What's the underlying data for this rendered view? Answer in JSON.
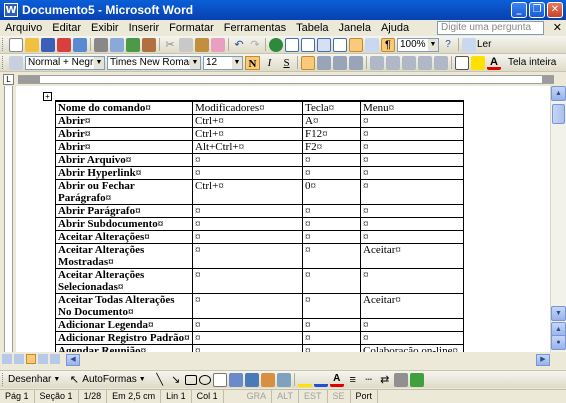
{
  "window": {
    "title": "Documento5 - Microsoft Word",
    "app_icon": "W"
  },
  "menu": [
    "Arquivo",
    "Editar",
    "Exibir",
    "Inserir",
    "Formatar",
    "Ferramentas",
    "Tabela",
    "Janela",
    "Ajuda"
  ],
  "help_box": {
    "placeholder": "Digite uma pergunta"
  },
  "standard_toolbar": {
    "zoom": "100%",
    "read_label": "Ler"
  },
  "format_toolbar": {
    "style": "Normal + Negrito",
    "font": "Times New Roman",
    "size": "12",
    "bold": "N",
    "italic": "I",
    "underline": "S",
    "full_screen_label": "Tela inteira"
  },
  "table": {
    "headers": [
      "Nome do comando",
      "Modificadores",
      "Tecla",
      "Menu"
    ],
    "rows": [
      [
        "Abrir",
        "Ctrl+",
        "A",
        ""
      ],
      [
        "Abrir",
        "Ctrl+",
        "F12",
        ""
      ],
      [
        "Abrir",
        "Alt+Ctrl+",
        "F2",
        ""
      ],
      [
        "Abrir Arquivo",
        "",
        "",
        ""
      ],
      [
        "Abrir Hyperlink",
        "",
        "",
        ""
      ],
      [
        "Abrir ou Fechar Parágrafo",
        "Ctrl+",
        "0",
        ""
      ],
      [
        "Abrir Parágrafo",
        "",
        "",
        ""
      ],
      [
        "Abrir Subdocumento",
        "",
        "",
        ""
      ],
      [
        "Aceitar Alterações",
        "",
        "",
        ""
      ],
      [
        "Aceitar Alterações Mostradas",
        "",
        "",
        "Aceitar"
      ],
      [
        "Aceitar Alterações Selecionadas",
        "",
        "",
        ""
      ],
      [
        "Aceitar Todas Alterações No Documento",
        "",
        "",
        "Aceitar"
      ],
      [
        "Adicionar Legenda",
        "",
        "",
        ""
      ],
      [
        "Adicionar Registro Padrão",
        "",
        "",
        ""
      ],
      [
        "Agendar Reunião",
        "",
        "",
        "Colaboração on-line"
      ]
    ]
  },
  "drawing_toolbar": {
    "draw_label": "Desenhar",
    "autoshapes_label": "AutoFormas"
  },
  "status_bar": {
    "page": "Pág 1",
    "section": "Seção 1",
    "pages": "1/28",
    "at": "Em 2,5 cm",
    "line": "Lin 1",
    "col": "Col 1",
    "indicators": [
      "GRA",
      "ALT",
      "EST",
      "SE"
    ],
    "language": "Port"
  }
}
